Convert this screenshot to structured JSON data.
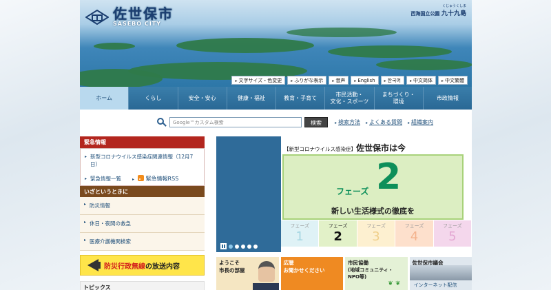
{
  "header": {
    "city_jp": "佐世保市",
    "city_en": "SASEBO CITY",
    "park_ruby": "くじゅうくしま",
    "park_label": "西海国立公園",
    "park_name": "九十九島"
  },
  "utility": [
    "文字サイズ・色変更",
    "ふりがな表示",
    "音声",
    "English",
    "한국어",
    "中文简体",
    "中文繁體"
  ],
  "nav": [
    "ホーム",
    "くらし",
    "安全・安心",
    "健康・福祉",
    "教育・子育て",
    "市民活動・\n文化・スポーツ",
    "まちづくり・\n環境",
    "市政情報"
  ],
  "search": {
    "placeholder": "Google™カスタム検索",
    "button": "検索",
    "links": [
      "検索方法",
      "よくある質問",
      "組織案内"
    ]
  },
  "emergency": {
    "title": "緊急情報",
    "item": "新型コロナウイルス感染症関連情報（12月7日）",
    "list_link": "緊急情報一覧",
    "rss_link": "緊急情報RSS"
  },
  "readiness": {
    "title": "いざというときに",
    "items": [
      "防災情報",
      "休日・夜間の救急",
      "医療介護機関検索"
    ]
  },
  "bousai": {
    "red": "防災行政無線",
    "rest": "の放送内容"
  },
  "topics": {
    "title": "トピックス"
  },
  "slider": {
    "tag": "【新型コロナウイルス感染症】",
    "city": "佐世保市は今",
    "phase_label": "フェーズ",
    "phase_number": "2",
    "message": "新しい生活様式の徹底を",
    "tabs": [
      {
        "label": "フェーズ",
        "num": "1"
      },
      {
        "label": "フェーズ",
        "num": "2"
      },
      {
        "label": "フェーズ",
        "num": "3"
      },
      {
        "label": "フェーズ",
        "num": "4"
      },
      {
        "label": "フェーズ",
        "num": "5"
      }
    ]
  },
  "banners": {
    "mayor_line1": "ようこそ",
    "mayor_line2": "市長の部屋",
    "hearing_line1": "広聴",
    "hearing_line2": "お聞かせください",
    "citizen_line1": "市民協働",
    "citizen_line2": "(地域コミュニティ・",
    "citizen_line3": "NPO等)",
    "council_title": "佐世保市議会",
    "council_link": "インターネット配信"
  },
  "colors": {
    "nav_blue": "#2c6f9c",
    "emergency_red": "#b3261e",
    "phase_green": "#0d8f5a"
  }
}
